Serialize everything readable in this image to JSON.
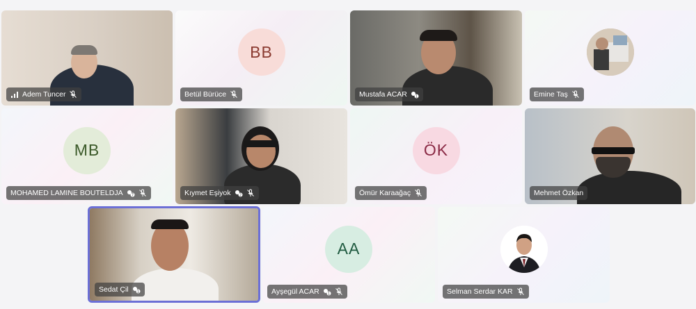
{
  "participants": [
    {
      "name": "Adem Tuncer",
      "mic": "muted",
      "signal": true,
      "video": true
    },
    {
      "name": "Betül Bürüce",
      "initials": "BB",
      "mic": "muted",
      "avatar_bg": "#f8dcd8",
      "avatar_fg": "#8a3a30"
    },
    {
      "name": "Mustafa ACAR",
      "mic": "raised-hand",
      "hand_count": "1",
      "video": true
    },
    {
      "name": "Emine Taş",
      "mic": "muted",
      "photo_avatar": true
    },
    {
      "name": "MOHAMED LAMINE BOUTELDJA",
      "initials": "MB",
      "mic": "muted",
      "hand": true,
      "hand_count": "7",
      "avatar_bg": "#e3ecd9",
      "avatar_fg": "#3c5a2a"
    },
    {
      "name": "Kıymet Eşiyok",
      "mic": "muted",
      "hand": true,
      "hand_count": "2",
      "video": true
    },
    {
      "name": "Ömür Karaağaç",
      "initials": "ÖK",
      "mic": "muted",
      "avatar_bg": "#f8d9e2",
      "avatar_fg": "#8a2a45"
    },
    {
      "name": "Mehmet Özkan",
      "video": true
    },
    {
      "name": "Sedat Çil",
      "hand": true,
      "hand_count": "1",
      "video": true,
      "speaking": true
    },
    {
      "name": "Ayşegül ACAR",
      "initials": "AA",
      "mic": "muted",
      "hand": true,
      "hand_count": "1",
      "avatar_bg": "#d7ede2",
      "avatar_fg": "#1f5a40"
    },
    {
      "name": "Selman Serdar KAR",
      "mic": "muted",
      "photo_avatar": true
    }
  ],
  "colors": {
    "speaking_border": "#6b6fd6",
    "nameplate_bg": "#404040"
  }
}
